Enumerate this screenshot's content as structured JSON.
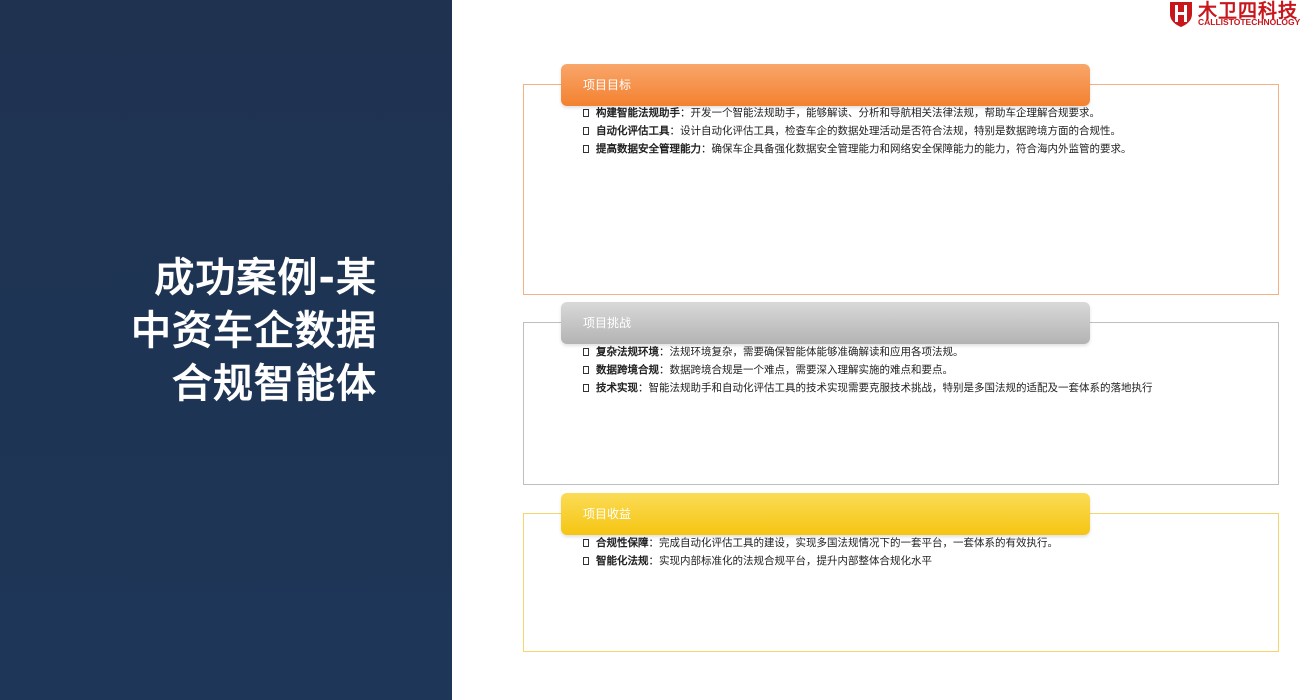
{
  "slide": {
    "title_lines": [
      "成功案例-某",
      "中资车企数据",
      "合规智能体"
    ]
  },
  "logo": {
    "name": "木卫四科技",
    "subtitle": "CALLISTOTECHNOLOGY",
    "icon": "shield-logo-icon",
    "brand_color": "#c8161d"
  },
  "colors": {
    "left_panel": "#1f3250",
    "goals_header": "#f3812f",
    "challenges_header": "#b3b3b3",
    "benefits_header": "#f6c512"
  },
  "sections": {
    "goals": {
      "header": "项目目标",
      "items": [
        {
          "term": "构建智能法规助手",
          "sep": "：",
          "desc": "开发一个智能法规助手，能够解读、分析和导航相关法律法规，帮助车企理解合规要求。"
        },
        {
          "term": "自动化评估工具",
          "sep": "：",
          "desc": "设计自动化评估工具，检查车企的数据处理活动是否符合法规，特别是数据跨境方面的合规性。"
        },
        {
          "term": "提高数据安全管理能力",
          "sep": "：",
          "desc": "确保车企具备强化数据安全管理能力和网络安全保障能力的能力，符合海内外监管的要求。"
        }
      ]
    },
    "challenges": {
      "header": "项目挑战",
      "items": [
        {
          "term": "复杂法规环境",
          "sep": "：",
          "desc": "法规环境复杂，需要确保智能体能够准确解读和应用各项法规。"
        },
        {
          "term": "数据跨境合规",
          "sep": "：",
          "desc": "数据跨境合规是一个难点，需要深入理解实施的难点和要点。"
        },
        {
          "term": "技术实现",
          "sep": "：",
          "desc": "智能法规助手和自动化评估工具的技术实现需要克服技术挑战，特别是多国法规的适配及一套体系的落地执行"
        }
      ]
    },
    "benefits": {
      "header": "项目收益",
      "items": [
        {
          "term": "合规性保障",
          "sep": "：",
          "desc": "完成自动化评估工具的建设，实现多国法规情况下的一套平台，一套体系的有效执行。"
        },
        {
          "term": "智能化法规",
          "sep": "：",
          "desc": "实现内部标准化的法规合规平台，提升内部整体合规化水平"
        }
      ]
    }
  }
}
